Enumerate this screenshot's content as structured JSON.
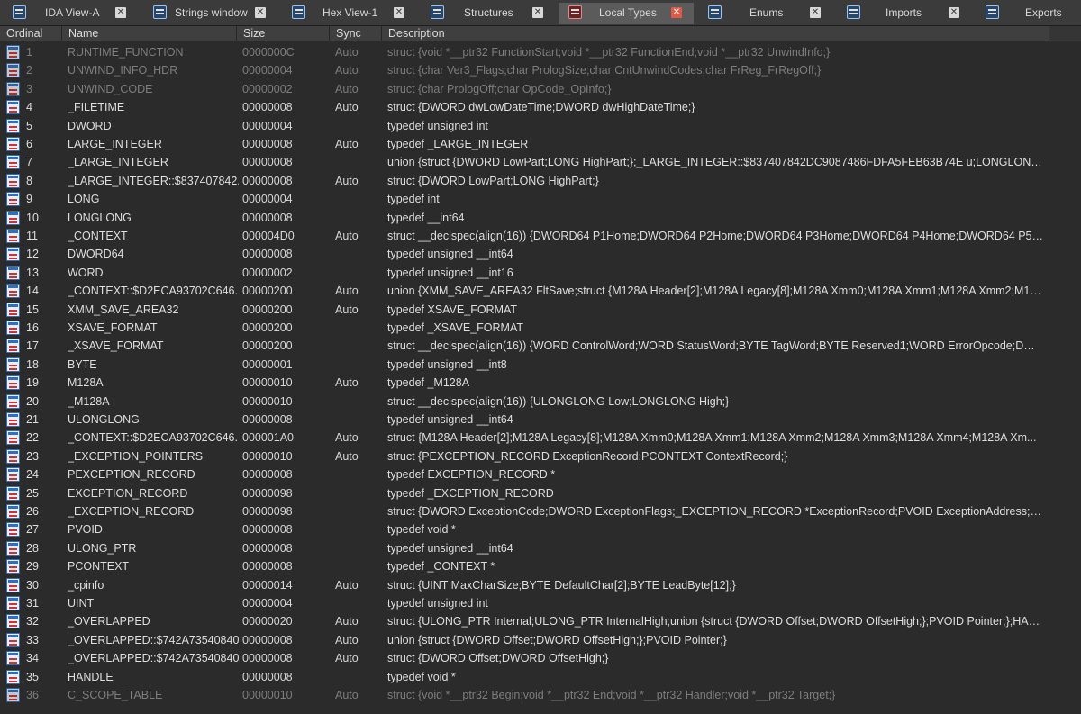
{
  "tabs": [
    {
      "label": "IDA View-A",
      "active": false
    },
    {
      "label": "Strings window",
      "active": false
    },
    {
      "label": "Hex View-1",
      "active": false
    },
    {
      "label": "Structures",
      "active": false
    },
    {
      "label": "Local Types",
      "active": true
    },
    {
      "label": "Enums",
      "active": false
    },
    {
      "label": "Imports",
      "active": false
    },
    {
      "label": "Exports",
      "active": false
    }
  ],
  "columns": [
    "Ordinal",
    "Name",
    "Size",
    "Sync",
    "Description"
  ],
  "rows": [
    {
      "ordinal": "1",
      "name": "RUNTIME_FUNCTION",
      "size": "0000000C",
      "sync": "Auto",
      "description": "struct {void *__ptr32 FunctionStart;void *__ptr32 FunctionEnd;void *__ptr32 UnwindInfo;}",
      "dim": true
    },
    {
      "ordinal": "2",
      "name": "UNWIND_INFO_HDR",
      "size": "00000004",
      "sync": "Auto",
      "description": "struct {char Ver3_Flags;char PrologSize;char CntUnwindCodes;char FrReg_FrRegOff;}",
      "dim": true
    },
    {
      "ordinal": "3",
      "name": "UNWIND_CODE",
      "size": "00000002",
      "sync": "Auto",
      "description": "struct {char PrologOff;char OpCode_OpInfo;}",
      "dim": true
    },
    {
      "ordinal": "4",
      "name": "_FILETIME",
      "size": "00000008",
      "sync": "Auto",
      "description": "struct {DWORD dwLowDateTime;DWORD dwHighDateTime;}",
      "dim": false
    },
    {
      "ordinal": "5",
      "name": "DWORD",
      "size": "00000004",
      "sync": "",
      "description": "typedef unsigned int",
      "dim": false
    },
    {
      "ordinal": "6",
      "name": "LARGE_INTEGER",
      "size": "00000008",
      "sync": "Auto",
      "description": "typedef _LARGE_INTEGER",
      "dim": false
    },
    {
      "ordinal": "7",
      "name": "_LARGE_INTEGER",
      "size": "00000008",
      "sync": "",
      "description": "union {struct {DWORD LowPart;LONG HighPart;};_LARGE_INTEGER::$837407842DC9087486FDFA5FEB63B74E u;LONGLONG Quad...",
      "dim": false
    },
    {
      "ordinal": "8",
      "name": "_LARGE_INTEGER::$837407842...",
      "size": "00000008",
      "sync": "Auto",
      "description": "struct {DWORD LowPart;LONG HighPart;}",
      "dim": false
    },
    {
      "ordinal": "9",
      "name": "LONG",
      "size": "00000004",
      "sync": "",
      "description": "typedef int",
      "dim": false
    },
    {
      "ordinal": "10",
      "name": "LONGLONG",
      "size": "00000008",
      "sync": "",
      "description": "typedef __int64",
      "dim": false
    },
    {
      "ordinal": "11",
      "name": "_CONTEXT",
      "size": "000004D0",
      "sync": "Auto",
      "description": "struct __declspec(align(16)) {DWORD64 P1Home;DWORD64 P2Home;DWORD64 P3Home;DWORD64 P4Home;DWORD64 P5Ho...",
      "dim": false
    },
    {
      "ordinal": "12",
      "name": "DWORD64",
      "size": "00000008",
      "sync": "",
      "description": "typedef unsigned __int64",
      "dim": false
    },
    {
      "ordinal": "13",
      "name": "WORD",
      "size": "00000002",
      "sync": "",
      "description": "typedef unsigned __int16",
      "dim": false
    },
    {
      "ordinal": "14",
      "name": "_CONTEXT::$D2ECA93702C646...",
      "size": "00000200",
      "sync": "Auto",
      "description": "union {XMM_SAVE_AREA32 FltSave;struct {M128A Header[2];M128A Legacy[8];M128A Xmm0;M128A Xmm1;M128A Xmm2;M128...",
      "dim": false
    },
    {
      "ordinal": "15",
      "name": "XMM_SAVE_AREA32",
      "size": "00000200",
      "sync": "Auto",
      "description": "typedef XSAVE_FORMAT",
      "dim": false
    },
    {
      "ordinal": "16",
      "name": "XSAVE_FORMAT",
      "size": "00000200",
      "sync": "",
      "description": "typedef _XSAVE_FORMAT",
      "dim": false
    },
    {
      "ordinal": "17",
      "name": "_XSAVE_FORMAT",
      "size": "00000200",
      "sync": "",
      "description": "struct __declspec(align(16)) {WORD ControlWord;WORD StatusWord;BYTE TagWord;BYTE Reserved1;WORD ErrorOpcode;DWOR...",
      "dim": false
    },
    {
      "ordinal": "18",
      "name": "BYTE",
      "size": "00000001",
      "sync": "",
      "description": "typedef unsigned __int8",
      "dim": false
    },
    {
      "ordinal": "19",
      "name": "M128A",
      "size": "00000010",
      "sync": "Auto",
      "description": "typedef _M128A",
      "dim": false
    },
    {
      "ordinal": "20",
      "name": "_M128A",
      "size": "00000010",
      "sync": "",
      "description": "struct __declspec(align(16)) {ULONGLONG Low;LONGLONG High;}",
      "dim": false
    },
    {
      "ordinal": "21",
      "name": "ULONGLONG",
      "size": "00000008",
      "sync": "",
      "description": "typedef unsigned __int64",
      "dim": false
    },
    {
      "ordinal": "22",
      "name": "_CONTEXT::$D2ECA93702C646...",
      "size": "000001A0",
      "sync": "Auto",
      "description": "struct {M128A Header[2];M128A Legacy[8];M128A Xmm0;M128A Xmm1;M128A Xmm2;M128A Xmm3;M128A Xmm4;M128A Xm...",
      "dim": false
    },
    {
      "ordinal": "23",
      "name": "_EXCEPTION_POINTERS",
      "size": "00000010",
      "sync": "Auto",
      "description": "struct {PEXCEPTION_RECORD ExceptionRecord;PCONTEXT ContextRecord;}",
      "dim": false
    },
    {
      "ordinal": "24",
      "name": "PEXCEPTION_RECORD",
      "size": "00000008",
      "sync": "",
      "description": "typedef EXCEPTION_RECORD *",
      "dim": false
    },
    {
      "ordinal": "25",
      "name": "EXCEPTION_RECORD",
      "size": "00000098",
      "sync": "",
      "description": "typedef _EXCEPTION_RECORD",
      "dim": false
    },
    {
      "ordinal": "26",
      "name": "_EXCEPTION_RECORD",
      "size": "00000098",
      "sync": "",
      "description": "struct {DWORD ExceptionCode;DWORD ExceptionFlags;_EXCEPTION_RECORD *ExceptionRecord;PVOID ExceptionAddress;DWO...",
      "dim": false
    },
    {
      "ordinal": "27",
      "name": "PVOID",
      "size": "00000008",
      "sync": "",
      "description": "typedef void *",
      "dim": false
    },
    {
      "ordinal": "28",
      "name": "ULONG_PTR",
      "size": "00000008",
      "sync": "",
      "description": "typedef unsigned __int64",
      "dim": false
    },
    {
      "ordinal": "29",
      "name": "PCONTEXT",
      "size": "00000008",
      "sync": "",
      "description": "typedef _CONTEXT *",
      "dim": false
    },
    {
      "ordinal": "30",
      "name": "_cpinfo",
      "size": "00000014",
      "sync": "Auto",
      "description": "struct {UINT MaxCharSize;BYTE DefaultChar[2];BYTE LeadByte[12];}",
      "dim": false
    },
    {
      "ordinal": "31",
      "name": "UINT",
      "size": "00000004",
      "sync": "",
      "description": "typedef unsigned int",
      "dim": false
    },
    {
      "ordinal": "32",
      "name": "_OVERLAPPED",
      "size": "00000020",
      "sync": "Auto",
      "description": "struct {ULONG_PTR Internal;ULONG_PTR InternalHigh;union {struct {DWORD Offset;DWORD OffsetHigh;};PVOID Pointer;};HANDLE...",
      "dim": false
    },
    {
      "ordinal": "33",
      "name": "_OVERLAPPED::$742A73540840...",
      "size": "00000008",
      "sync": "Auto",
      "description": "union {struct {DWORD Offset;DWORD OffsetHigh;};PVOID Pointer;}",
      "dim": false
    },
    {
      "ordinal": "34",
      "name": "_OVERLAPPED::$742A73540840...",
      "size": "00000008",
      "sync": "Auto",
      "description": "struct {DWORD Offset;DWORD OffsetHigh;}",
      "dim": false
    },
    {
      "ordinal": "35",
      "name": "HANDLE",
      "size": "00000008",
      "sync": "",
      "description": "typedef void *",
      "dim": false
    },
    {
      "ordinal": "36",
      "name": "C_SCOPE_TABLE",
      "size": "00000010",
      "sync": "Auto",
      "description": "struct {void *__ptr32 Begin;void *__ptr32 End;void *__ptr32 Handler;void *__ptr32 Target;}",
      "dim": true
    }
  ]
}
